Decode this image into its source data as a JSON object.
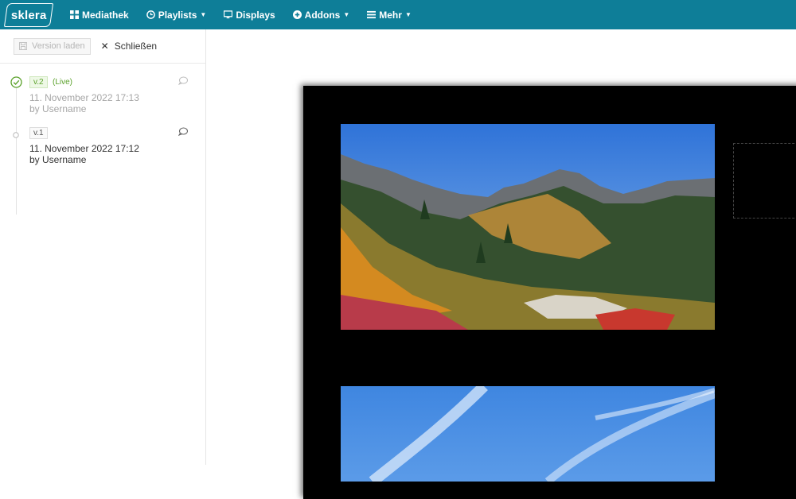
{
  "nav": {
    "logo": "sklera",
    "items": [
      {
        "label": "Mediathek",
        "icon": "grid-icon",
        "dropdown": false
      },
      {
        "label": "Playlists",
        "icon": "clock-icon",
        "dropdown": true
      },
      {
        "label": "Displays",
        "icon": "monitor-icon",
        "dropdown": false
      },
      {
        "label": "Addons",
        "icon": "plus-circle-icon",
        "dropdown": true
      },
      {
        "label": "Mehr",
        "icon": "list-icon",
        "dropdown": true
      }
    ]
  },
  "sidebar": {
    "load_version_label": "Version laden",
    "close_label": "Schließen",
    "versions": [
      {
        "tag": "v.2",
        "status": "(Live)",
        "date": "11. November 2022 17:13",
        "user": "by Username",
        "live": true
      },
      {
        "tag": "v.1",
        "status": "",
        "date": "11. November 2022 17:12",
        "user": "by Username",
        "live": false
      }
    ]
  },
  "colors": {
    "nav_bg": "#0e7e98",
    "live_green": "#5aa12a",
    "preview_bg": "#000000"
  }
}
